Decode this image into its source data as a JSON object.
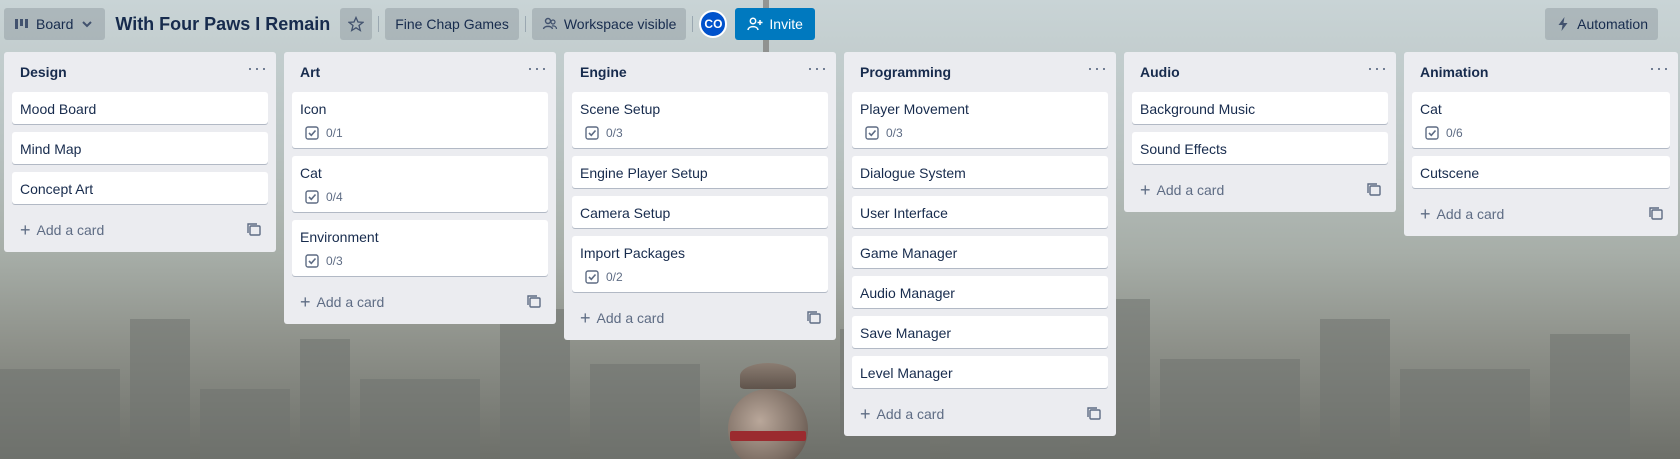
{
  "header": {
    "view_label": "Board",
    "title": "With Four Paws I Remain",
    "workspace": "Fine Chap Games",
    "visibility": "Workspace visible",
    "avatar_initials": "CO",
    "invite_label": "Invite",
    "automation_label": "Automation"
  },
  "add_card_label": "Add a card",
  "lists": [
    {
      "title": "Design",
      "cards": [
        {
          "title": "Mood Board"
        },
        {
          "title": "Mind Map"
        },
        {
          "title": "Concept Art"
        }
      ]
    },
    {
      "title": "Art",
      "cards": [
        {
          "title": "Icon",
          "checklist": "0/1"
        },
        {
          "title": "Cat",
          "checklist": "0/4"
        },
        {
          "title": "Environment",
          "checklist": "0/3"
        }
      ]
    },
    {
      "title": "Engine",
      "cards": [
        {
          "title": "Scene Setup",
          "checklist": "0/3"
        },
        {
          "title": "Engine Player Setup"
        },
        {
          "title": "Camera Setup"
        },
        {
          "title": "Import Packages",
          "checklist": "0/2"
        }
      ]
    },
    {
      "title": "Programming",
      "cards": [
        {
          "title": "Player Movement",
          "checklist": "0/3"
        },
        {
          "title": "Dialogue System"
        },
        {
          "title": "User Interface"
        },
        {
          "title": "Game Manager"
        },
        {
          "title": "Audio Manager"
        },
        {
          "title": "Save Manager"
        },
        {
          "title": "Level Manager"
        }
      ]
    },
    {
      "title": "Audio",
      "cards": [
        {
          "title": "Background Music"
        },
        {
          "title": "Sound Effects"
        }
      ]
    },
    {
      "title": "Animation",
      "cards": [
        {
          "title": "Cat",
          "checklist": "0/6"
        },
        {
          "title": "Cutscene"
        }
      ]
    }
  ],
  "colors": {
    "invite": "#0079bf",
    "avatar": "#0052cc",
    "list_bg": "#ebecf0"
  }
}
